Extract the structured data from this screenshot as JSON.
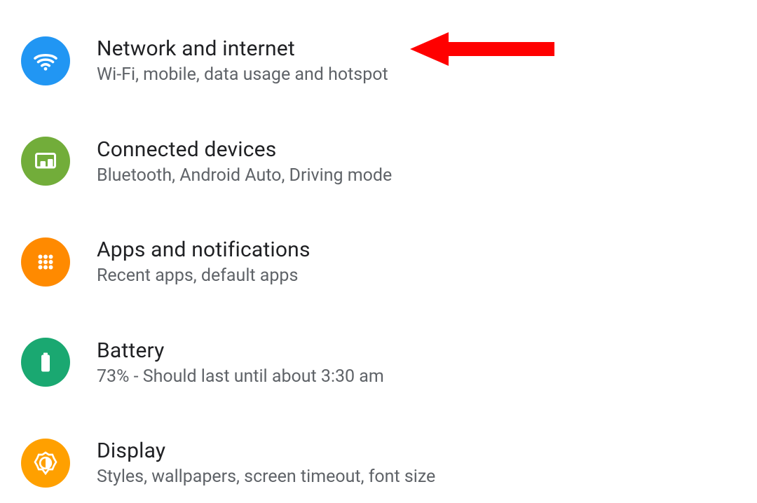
{
  "settings": {
    "items": [
      {
        "title": "Network and internet",
        "subtitle": "Wi-Fi, mobile, data usage and hotspot",
        "icon": "wifi-icon",
        "color": "#2196f3"
      },
      {
        "title": "Connected devices",
        "subtitle": "Bluetooth, Android Auto, Driving mode",
        "icon": "devices-icon",
        "color": "#72ad3a"
      },
      {
        "title": "Apps and notifications",
        "subtitle": "Recent apps, default apps",
        "icon": "apps-icon",
        "color": "#ff8a00"
      },
      {
        "title": "Battery",
        "subtitle": "73% - Should last until about 3:30 am",
        "icon": "battery-icon",
        "color": "#1aa871"
      },
      {
        "title": "Display",
        "subtitle": "Styles, wallpapers, screen timeout, font size",
        "icon": "display-icon",
        "color": "#ffa000"
      }
    ]
  },
  "annotation": {
    "arrow_color": "#ff0000",
    "target_item_index": 0
  }
}
